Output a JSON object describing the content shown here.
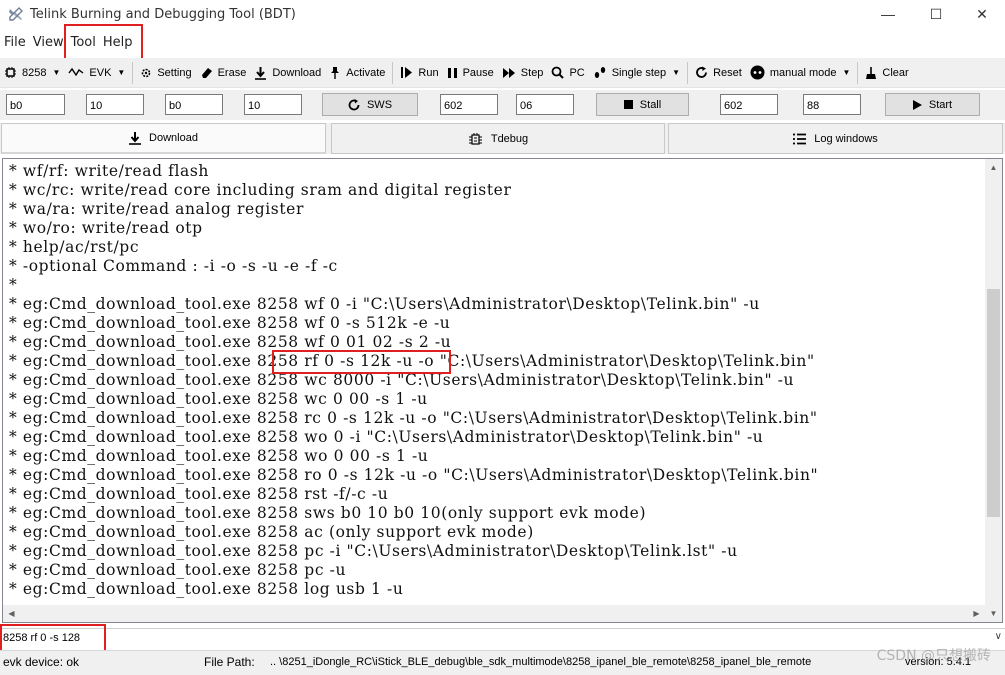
{
  "window": {
    "title": "Telink Burning and Debugging Tool (BDT)",
    "minimize": "—",
    "maximize": "☐",
    "close": "✕"
  },
  "menu": [
    "File",
    "View",
    "Tool",
    "Help"
  ],
  "toolbar": {
    "chip": "8258",
    "board": "EVK",
    "setting": "Setting",
    "erase": "Erase",
    "download": "Download",
    "activate": "Activate",
    "run": "Run",
    "pause": "Pause",
    "step": "Step",
    "pc": "PC",
    "single_step": "Single step",
    "reset": "Reset",
    "manual_mode": "manual mode",
    "clear": "Clear"
  },
  "inputs": {
    "sws_a": "b0",
    "sws_b": "10",
    "sws_c": "b0",
    "sws_d": "10",
    "sws_button": "SWS",
    "stall_a": "602",
    "stall_b": "06",
    "stall_button": "Stall",
    "start_a": "602",
    "start_b": "88",
    "start_button": "Start"
  },
  "tabs": [
    "Download",
    "Tdebug",
    "Log windows"
  ],
  "console_lines": [
    "* wf/rf: write/read flash",
    "* wc/rc: write/read core including sram and digital register",
    "* wa/ra: write/read analog register",
    "* wo/ro: write/read otp",
    "* help/ac/rst/pc",
    "* -optional Command : -i -o -s -u -e -f -c",
    "*",
    "* eg:Cmd_download_tool.exe 8258 wf 0 -i \"C:\\Users\\Administrator\\Desktop\\Telink.bin\" -u",
    "* eg:Cmd_download_tool.exe 8258 wf 0 -s 512k -e -u",
    "* eg:Cmd_download_tool.exe 8258 wf 0 01 02 -s 2 -u",
    "* eg:Cmd_download_tool.exe 8258 rf 0 -s 12k -u -o \"C:\\Users\\Administrator\\Desktop\\Telink.bin\"",
    "* eg:Cmd_download_tool.exe 8258 wc 8000 -i \"C:\\Users\\Administrator\\Desktop\\Telink.bin\" -u",
    "* eg:Cmd_download_tool.exe 8258 wc 0 00 -s 1 -u",
    "* eg:Cmd_download_tool.exe 8258 rc 0 -s 12k -u -o \"C:\\Users\\Administrator\\Desktop\\Telink.bin\"",
    "* eg:Cmd_download_tool.exe 8258 wo 0 -i \"C:\\Users\\Administrator\\Desktop\\Telink.bin\" -u",
    "* eg:Cmd_download_tool.exe 8258 wo 0 00 -s 1 -u",
    "* eg:Cmd_download_tool.exe 8258 ro 0 -s 12k -u -o \"C:\\Users\\Administrator\\Desktop\\Telink.bin\"",
    "* eg:Cmd_download_tool.exe 8258 rst -f/-c -u",
    "* eg:Cmd_download_tool.exe 8258 sws b0 10 b0 10(only support evk mode)",
    "* eg:Cmd_download_tool.exe 8258 ac (only support evk mode)",
    "* eg:Cmd_download_tool.exe 8258 pc -i \"C:\\Users\\Administrator\\Desktop\\Telink.lst\" -u",
    "* eg:Cmd_download_tool.exe 8258 pc -u",
    "* eg:Cmd_download_tool.exe 8258 log usb 1 -u"
  ],
  "command": {
    "value": "8258 rf 0 -s 128"
  },
  "status": {
    "device": "evk device: ok",
    "file_path_label": "File Path:",
    "file_path": "..  \\8251_iDongle_RC\\iStick_BLE_debug\\ble_sdk_multimode\\8258_ipanel_ble_remote\\8258_ipanel_ble_remote",
    "version": "version: 5.4.1"
  },
  "watermark": "CSDN @只想搬砖"
}
